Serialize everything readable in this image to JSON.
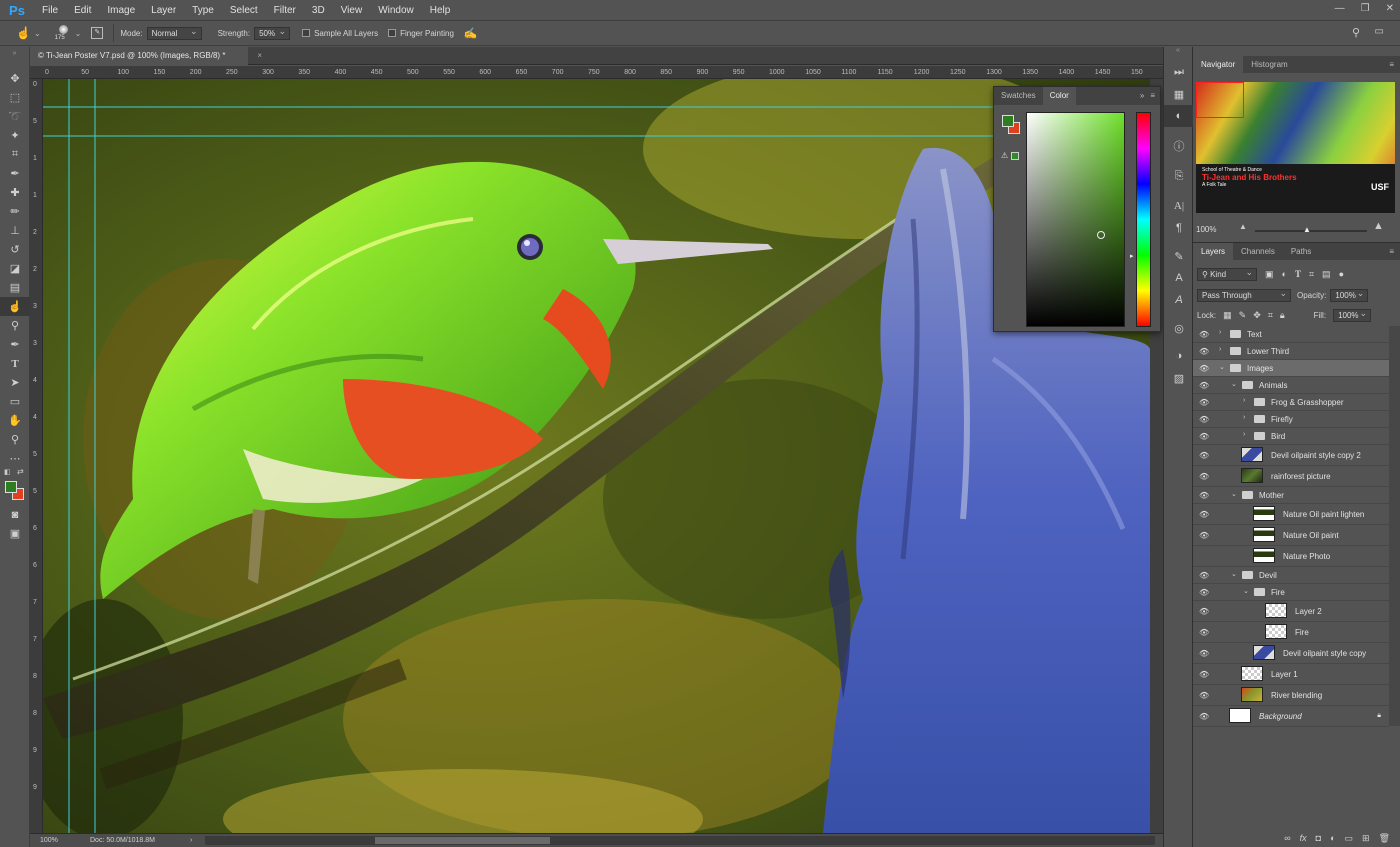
{
  "app": {
    "logo": "Ps"
  },
  "menu": [
    "File",
    "Edit",
    "Image",
    "Layer",
    "Type",
    "Select",
    "Filter",
    "3D",
    "View",
    "Window",
    "Help"
  ],
  "window_controls": {
    "minimize": "—",
    "maximize": "❐",
    "close": "✕"
  },
  "options": {
    "brush_size": "175",
    "mode_label": "Mode:",
    "mode_value": "Normal",
    "strength_label": "Strength:",
    "strength_value": "50%",
    "sample_all_label": "Sample All Layers",
    "finger_painting_label": "Finger Painting"
  },
  "document": {
    "tab_title": "© Ti-Jean Poster V7.psd @ 100% (Images, RGB/8) *",
    "close": "×"
  },
  "ruler": {
    "h_ticks": [
      "0",
      "50",
      "100",
      "150",
      "200",
      "250",
      "300",
      "350",
      "400",
      "450",
      "500",
      "550",
      "600",
      "650",
      "700",
      "750",
      "800",
      "850",
      "900",
      "950",
      "1000",
      "1050",
      "1100",
      "1150",
      "1200",
      "1250",
      "1300",
      "1350",
      "1400",
      "1450",
      "150"
    ],
    "v_ticks": [
      "0",
      "5",
      "1",
      "1",
      "2",
      "2",
      "3",
      "3",
      "4",
      "4",
      "5",
      "5",
      "6",
      "6",
      "7",
      "7",
      "8",
      "8",
      "9",
      "9"
    ]
  },
  "status": {
    "zoom": "100%",
    "doc_info": "Doc: 50.0M/1018.8M"
  },
  "color_panel": {
    "tabs": [
      "Swatches",
      "Color"
    ],
    "active_tab": "Color",
    "fg_color": "#2e7d22",
    "bg_color": "#e0401e",
    "field_hue": "#6ee02a"
  },
  "navigator": {
    "tabs": [
      "Navigator",
      "Histogram"
    ],
    "zoom": "100%",
    "poster_lines": [
      "School of Theatre & Dance",
      "Ti-Jean and His Brothers",
      "A Folk Tale",
      "USF"
    ]
  },
  "layers_panel": {
    "tabs": [
      "Layers",
      "Channels",
      "Paths"
    ],
    "filter_kind": "Kind",
    "blend_mode": "Pass Through",
    "opacity_label": "Opacity:",
    "opacity_value": "100%",
    "lock_label": "Lock:",
    "fill_label": "Fill:",
    "fill_value": "100%",
    "layers": [
      {
        "name": "Text",
        "type": "folder",
        "level": 0,
        "expanded": false,
        "visible": true
      },
      {
        "name": "Lower Third",
        "type": "folder",
        "level": 0,
        "expanded": false,
        "visible": true
      },
      {
        "name": "Images",
        "type": "folder",
        "level": 0,
        "expanded": true,
        "visible": true,
        "selected": true
      },
      {
        "name": "Animals",
        "type": "folder",
        "level": 1,
        "expanded": true,
        "visible": true
      },
      {
        "name": "Frog & Grasshopper",
        "type": "folder",
        "level": 2,
        "expanded": false,
        "visible": true
      },
      {
        "name": "Firefly",
        "type": "folder",
        "level": 2,
        "expanded": false,
        "visible": true
      },
      {
        "name": "Bird",
        "type": "folder",
        "level": 2,
        "expanded": false,
        "visible": true
      },
      {
        "name": "Devil oilpaint style copy 2",
        "type": "layer",
        "level": 1,
        "visible": true,
        "thumb": "devil"
      },
      {
        "name": "rainforest picture",
        "type": "layer",
        "level": 1,
        "visible": true,
        "thumb": "forest"
      },
      {
        "name": "Mother",
        "type": "folder",
        "level": 1,
        "expanded": true,
        "visible": true
      },
      {
        "name": "Nature Oil paint lighten",
        "type": "layer",
        "level": 2,
        "visible": true,
        "thumb": "nature"
      },
      {
        "name": "Nature Oil paint",
        "type": "layer",
        "level": 2,
        "visible": true,
        "thumb": "nature"
      },
      {
        "name": "Nature Photo",
        "type": "layer",
        "level": 2,
        "visible": false,
        "thumb": "nature"
      },
      {
        "name": "Devil",
        "type": "folder",
        "level": 1,
        "expanded": true,
        "visible": true
      },
      {
        "name": "Fire",
        "type": "folder",
        "level": 2,
        "expanded": true,
        "visible": true
      },
      {
        "name": "Layer 2",
        "type": "layer",
        "level": 3,
        "visible": true,
        "thumb": "checker"
      },
      {
        "name": "Fire",
        "type": "layer",
        "level": 3,
        "visible": true,
        "thumb": "fire"
      },
      {
        "name": "Devil oilpaint style copy",
        "type": "layer",
        "level": 2,
        "visible": true,
        "thumb": "devil"
      },
      {
        "name": "Layer 1",
        "type": "layer",
        "level": 1,
        "visible": true,
        "thumb": "checker"
      },
      {
        "name": "River blending",
        "type": "layer",
        "level": 1,
        "visible": true,
        "thumb": "river"
      },
      {
        "name": "Background",
        "type": "layer",
        "level": 0,
        "visible": true,
        "thumb": "white",
        "italic": true,
        "locked": true
      }
    ]
  },
  "tools": [
    "move-tool",
    "marquee-tool",
    "lasso-tool",
    "quick-select-tool",
    "crop-tool",
    "eyedropper-tool",
    "healing-brush-tool",
    "brush-tool",
    "clone-stamp-tool",
    "history-brush-tool",
    "eraser-tool",
    "gradient-tool",
    "smudge-tool",
    "dodge-tool",
    "pen-tool",
    "type-tool",
    "path-select-tool",
    "rectangle-tool",
    "hand-tool",
    "zoom-tool",
    "more-tools"
  ]
}
